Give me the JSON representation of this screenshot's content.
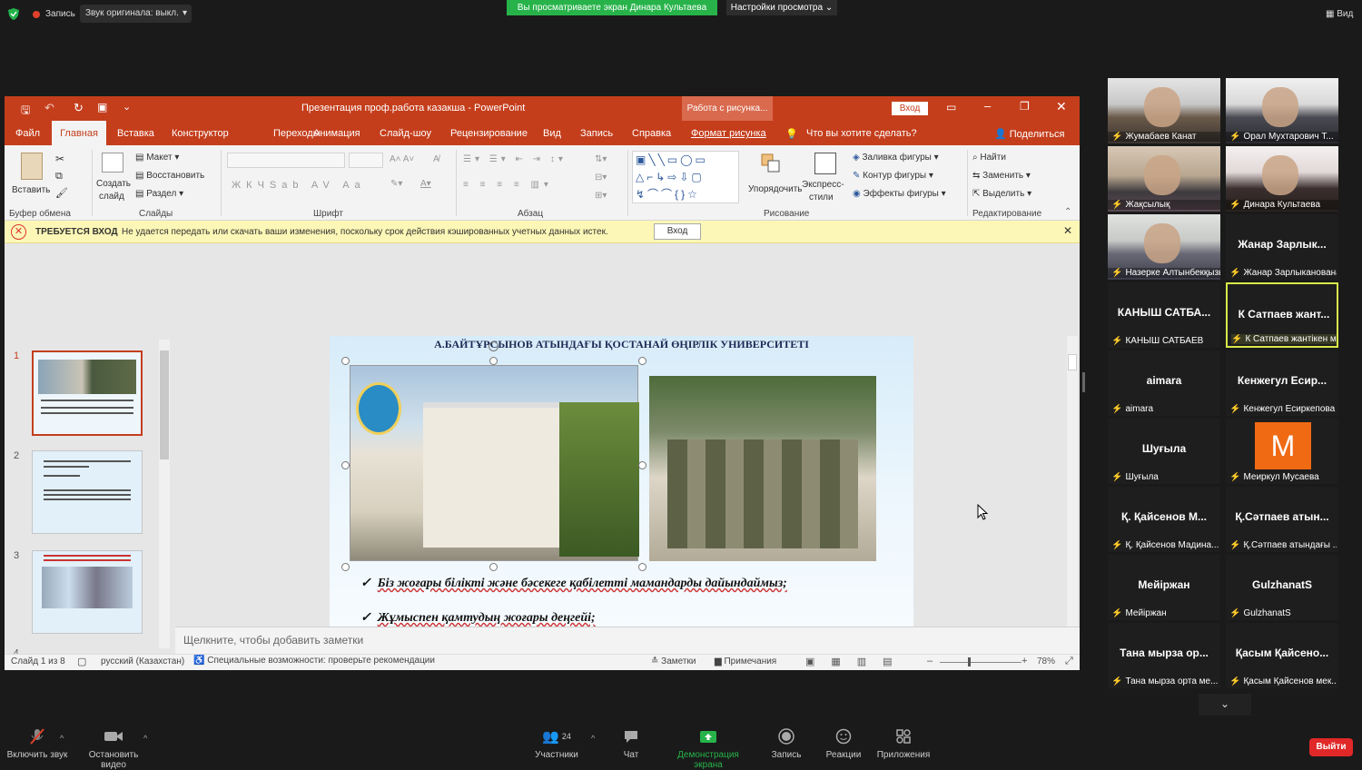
{
  "zoom_top": {
    "recording": "Запись",
    "audio": "Звук оригинала: выкл.",
    "sharing_banner": "Вы просматриваете экран Динара Культаева",
    "view_settings": "Настройки просмотра",
    "view": "Вид"
  },
  "ppt": {
    "title": "Презентация проф.работа казакша - PowerPoint",
    "context_tab": "Работа с рисунка...",
    "login": "Вход",
    "menu": [
      "Файл",
      "Главная",
      "Вставка",
      "Конструктор",
      "Переходы",
      "Анимация",
      "Слайд-шоу",
      "Рецензирование",
      "Вид",
      "Запись",
      "Справка",
      "Формат рисунка"
    ],
    "tell_me": "Что вы хотите сделать?",
    "share": "Поделиться",
    "ribbon": {
      "paste": "Вставить",
      "create_slide_1": "Создать",
      "create_slide_2": "слайд",
      "layout": "Макет",
      "restore": "Восстановить",
      "section": "Раздел",
      "arrange": "Упорядочить",
      "quick_styles_1": "Экспресс-",
      "quick_styles_2": "стили",
      "shape_fill": "Заливка фигуры",
      "shape_outline": "Контур фигуры",
      "shape_effects": "Эффекты фигуры",
      "find": "Найти",
      "replace": "Заменить",
      "select": "Выделить",
      "groups": [
        "Буфер обмена",
        "Слайды",
        "Шрифт",
        "Абзац",
        "Рисование",
        "Редактирование"
      ]
    },
    "warning": {
      "title": "ТРЕБУЕТСЯ ВХОД",
      "text": "Не удается передать или скачать ваши изменения, поскольку срок действия кэшированных учетных данных истек.",
      "button": "Вход"
    },
    "slide": {
      "header": "А.БАЙТҰРСЫНОВ АТЫНДАҒЫ ҚОСТАНАЙ ӨҢІРЛІК УНИВЕРСИТЕТІ",
      "bullet1": "Біз жоғары білікті және бәсекеге қабілетті мамандарды дайындаймыз;",
      "bullet2": "Жұмыспен қамтудың жоғары деңгейі;"
    },
    "slide_numbers": [
      "1",
      "2",
      "3",
      "4"
    ],
    "notes_placeholder": "Щелкните, чтобы добавить заметки",
    "status": {
      "slide_count": "Слайд 1 из 8",
      "language": "русский (Казахстан)",
      "accessibility": "Специальные возможности: проверьте рекомендации",
      "notes": "Заметки",
      "comments": "Примечания",
      "zoom": "78%"
    }
  },
  "participants": [
    {
      "name": "Жумабаев Канат",
      "big": "",
      "video": true
    },
    {
      "name": "Орал Мухтарович Т...",
      "big": "",
      "video": true
    },
    {
      "name": "Жақсылық",
      "big": "",
      "video": true
    },
    {
      "name": "Динара Культаева",
      "big": "",
      "video": true
    },
    {
      "name": "Назерке Алтынбекқызы",
      "big": "",
      "video": true
    },
    {
      "name": "Жанар Зарлыканована",
      "big": "Жанар Зарлык...",
      "video": false
    },
    {
      "name": "КАНЫШ САТБАЕВ",
      "big": "КАНЫШ САТБА...",
      "video": false
    },
    {
      "name": "К Сатпаев жантікен мек...",
      "big": "К Сатпаев жант...",
      "video": false
    },
    {
      "name": "aimara",
      "big": "aimara",
      "video": false
    },
    {
      "name": "Кенжегул Есиркепова",
      "big": "Кенжегул Есир...",
      "video": false
    },
    {
      "name": "Шуғыла",
      "big": "Шуғыла",
      "video": false
    },
    {
      "name": "Меиркул Мусаева",
      "big": "M",
      "video": false
    },
    {
      "name": "Қ. Қайсенов Мадина...",
      "big": "Қ. Қайсенов М...",
      "video": false
    },
    {
      "name": "Қ.Сәтпаев атындағы ...",
      "big": "Қ.Сәтпаев атын...",
      "video": false
    },
    {
      "name": "Мейіржан",
      "big": "Мейіржан",
      "video": false
    },
    {
      "name": "GulzhanatS",
      "big": "GulzhanatS",
      "video": false
    },
    {
      "name": "Тана мырза орта ме...",
      "big": "Тана мырза ор...",
      "video": false
    },
    {
      "name": "Қасым Қайсенов мек...",
      "big": "Қасым Қайсено...",
      "video": false
    }
  ],
  "zoom_bottom": {
    "unmute": "Включить звук",
    "stop_video": "Остановить видео",
    "participants": "Участники",
    "participants_count": "24",
    "chat": "Чат",
    "share_screen": "Демонстрация экрана",
    "record": "Запись",
    "reactions": "Реакции",
    "apps": "Приложения",
    "leave": "Выйти"
  },
  "colors": {
    "ppt_red": "#c43e1c",
    "zoom_green": "#27b34a",
    "leave_red": "#e02828",
    "highlight": "#d8e84a"
  }
}
